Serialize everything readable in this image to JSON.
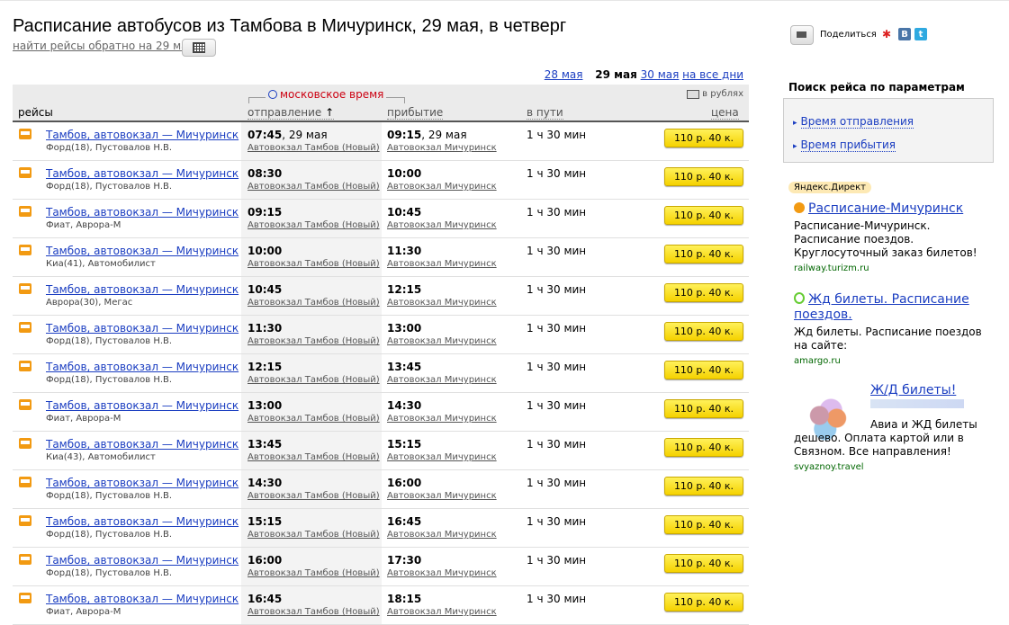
{
  "header": {
    "title": "Расписание автобусов из Тамбова в Мичуринск, 29 мая, в четверг",
    "back_link": "найти рейсы обратно на 29 мая"
  },
  "dates": {
    "prev": "28 мая",
    "current": "29 мая",
    "next": "30 мая",
    "all": "на все дни"
  },
  "table": {
    "timezone_note": "московское время",
    "currency_note": "в рублях",
    "columns": {
      "route": "рейсы",
      "departure": "отправление",
      "sort_arrow": "↑",
      "arrival": "прибытие",
      "duration": "в пути",
      "price": "цена"
    },
    "rows": [
      {
        "route": "Тамбов, автовокзал — Мичуринск",
        "carrier": "Форд(18), Пустовалов Н.В.",
        "dep_time": "07:45",
        "dep_date": ", 29 мая",
        "dep_station": "Автовокзал Тамбов (Новый)",
        "arr_time": "09:15",
        "arr_date": ", 29 мая",
        "arr_station": "Автовокзал Мичуринск",
        "duration": "1 ч 30 мин",
        "price": "110 р. 40 к."
      },
      {
        "route": "Тамбов, автовокзал — Мичуринск",
        "carrier": "Форд(18), Пустовалов Н.В.",
        "dep_time": "08:30",
        "dep_date": "",
        "dep_station": "Автовокзал Тамбов (Новый)",
        "arr_time": "10:00",
        "arr_date": "",
        "arr_station": "Автовокзал Мичуринск",
        "duration": "1 ч 30 мин",
        "price": "110 р. 40 к."
      },
      {
        "route": "Тамбов, автовокзал — Мичуринск",
        "carrier": "Фиат, Аврора-М",
        "dep_time": "09:15",
        "dep_date": "",
        "dep_station": "Автовокзал Тамбов (Новый)",
        "arr_time": "10:45",
        "arr_date": "",
        "arr_station": "Автовокзал Мичуринск",
        "duration": "1 ч 30 мин",
        "price": "110 р. 40 к."
      },
      {
        "route": "Тамбов, автовокзал — Мичуринск",
        "carrier": "Киа(41), Автомобилист",
        "dep_time": "10:00",
        "dep_date": "",
        "dep_station": "Автовокзал Тамбов (Новый)",
        "arr_time": "11:30",
        "arr_date": "",
        "arr_station": "Автовокзал Мичуринск",
        "duration": "1 ч 30 мин",
        "price": "110 р. 40 к."
      },
      {
        "route": "Тамбов, автовокзал — Мичуринск",
        "carrier": "Аврора(30), Мегас",
        "dep_time": "10:45",
        "dep_date": "",
        "dep_station": "Автовокзал Тамбов (Новый)",
        "arr_time": "12:15",
        "arr_date": "",
        "arr_station": "Автовокзал Мичуринск",
        "duration": "1 ч 30 мин",
        "price": "110 р. 40 к."
      },
      {
        "route": "Тамбов, автовокзал — Мичуринск",
        "carrier": "Форд(18), Пустовалов Н.В.",
        "dep_time": "11:30",
        "dep_date": "",
        "dep_station": "Автовокзал Тамбов (Новый)",
        "arr_time": "13:00",
        "arr_date": "",
        "arr_station": "Автовокзал Мичуринск",
        "duration": "1 ч 30 мин",
        "price": "110 р. 40 к."
      },
      {
        "route": "Тамбов, автовокзал — Мичуринск",
        "carrier": "Форд(18), Пустовалов Н.В.",
        "dep_time": "12:15",
        "dep_date": "",
        "dep_station": "Автовокзал Тамбов (Новый)",
        "arr_time": "13:45",
        "arr_date": "",
        "arr_station": "Автовокзал Мичуринск",
        "duration": "1 ч 30 мин",
        "price": "110 р. 40 к."
      },
      {
        "route": "Тамбов, автовокзал — Мичуринск",
        "carrier": "Фиат, Аврора-М",
        "dep_time": "13:00",
        "dep_date": "",
        "dep_station": "Автовокзал Тамбов (Новый)",
        "arr_time": "14:30",
        "arr_date": "",
        "arr_station": "Автовокзал Мичуринск",
        "duration": "1 ч 30 мин",
        "price": "110 р. 40 к."
      },
      {
        "route": "Тамбов, автовокзал — Мичуринск",
        "carrier": "Киа(43), Автомобилист",
        "dep_time": "13:45",
        "dep_date": "",
        "dep_station": "Автовокзал Тамбов (Новый)",
        "arr_time": "15:15",
        "arr_date": "",
        "arr_station": "Автовокзал Мичуринск",
        "duration": "1 ч 30 мин",
        "price": "110 р. 40 к."
      },
      {
        "route": "Тамбов, автовокзал — Мичуринск",
        "carrier": "Форд(18), Пустовалов Н.В.",
        "dep_time": "14:30",
        "dep_date": "",
        "dep_station": "Автовокзал Тамбов (Новый)",
        "arr_time": "16:00",
        "arr_date": "",
        "arr_station": "Автовокзал Мичуринск",
        "duration": "1 ч 30 мин",
        "price": "110 р. 40 к."
      },
      {
        "route": "Тамбов, автовокзал — Мичуринск",
        "carrier": "Форд(18), Пустовалов Н.В.",
        "dep_time": "15:15",
        "dep_date": "",
        "dep_station": "Автовокзал Тамбов (Новый)",
        "arr_time": "16:45",
        "arr_date": "",
        "arr_station": "Автовокзал Мичуринск",
        "duration": "1 ч 30 мин",
        "price": "110 р. 40 к."
      },
      {
        "route": "Тамбов, автовокзал — Мичуринск",
        "carrier": "Форд(18), Пустовалов Н.В.",
        "dep_time": "16:00",
        "dep_date": "",
        "dep_station": "Автовокзал Тамбов (Новый)",
        "arr_time": "17:30",
        "arr_date": "",
        "arr_station": "Автовокзал Мичуринск",
        "duration": "1 ч 30 мин",
        "price": "110 р. 40 к."
      },
      {
        "route": "Тамбов, автовокзал — Мичуринск",
        "carrier": "Фиат, Аврора-М",
        "dep_time": "16:45",
        "dep_date": "",
        "dep_station": "Автовокзал Тамбов (Новый)",
        "arr_time": "18:15",
        "arr_date": "",
        "arr_station": "Автовокзал Мичуринск",
        "duration": "1 ч 30 мин",
        "price": "110 р. 40 к."
      }
    ]
  },
  "sidebar": {
    "share_label": "Поделиться",
    "social": {
      "vk": "В",
      "twitter": "t"
    },
    "search_title": "Поиск рейса по параметрам",
    "search_items": [
      "Время отправления",
      "Время прибытия"
    ],
    "direct_label": "Яндекс.Директ",
    "ads": [
      {
        "title": "Расписание-Мичуринск",
        "text": "Расписание-Мичуринск. Расписание поездов. Круглосуточный заказ билетов!",
        "url": "railway.turizm.ru",
        "icon_color": "#f29a12"
      },
      {
        "title": "Жд билеты. Расписание поездов.",
        "text": "Жд билеты. Расписание поездов на сайте:",
        "url": "amargo.ru",
        "icon_color": "#6c3"
      },
      {
        "title": "Ж/Д билеты!",
        "text": "Авиа и ЖД билеты дешево. Оплата картой или в Связном. Все направления!",
        "url": "svyaznoy.travel"
      }
    ]
  },
  "colors": {
    "link": "#1a3dc1",
    "accent_red": "#cc0011",
    "price_yellow": "#f5d200",
    "bus_orange": "#f29a12"
  }
}
